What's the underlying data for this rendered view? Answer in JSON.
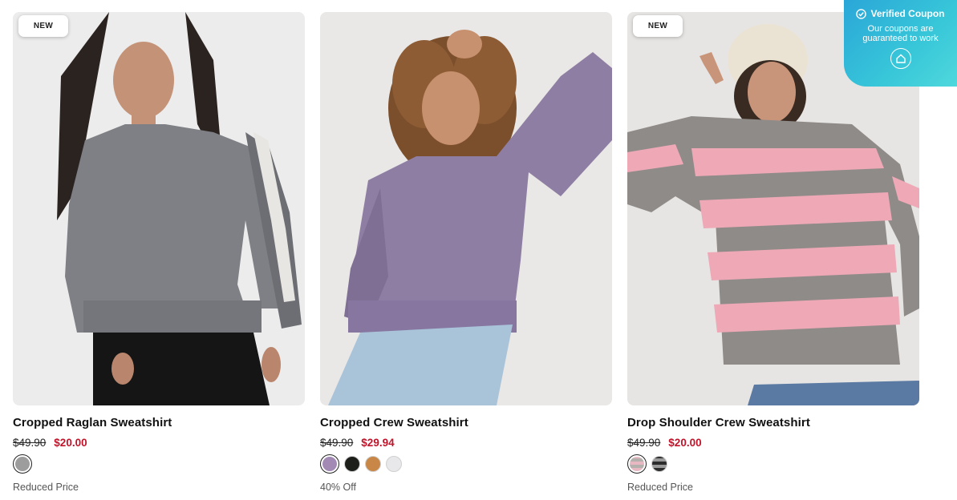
{
  "products": [
    {
      "badge": "NEW",
      "title": "Cropped Raglan Sweatshirt",
      "old_price": "$49.90",
      "new_price": "$20.00",
      "note": "Reduced Price",
      "swatches": [
        {
          "color": "#9d9d9d",
          "selected": true
        }
      ]
    },
    {
      "badge": "",
      "title": "Cropped Crew Sweatshirt",
      "old_price": "$49.90",
      "new_price": "$29.94",
      "note": "40% Off",
      "swatches": [
        {
          "color": "#a38ab5",
          "selected": true
        },
        {
          "color": "#1d1f1a",
          "selected": false
        },
        {
          "color": "#c88746",
          "selected": false
        },
        {
          "color": "#e8e8ea",
          "selected": false
        }
      ]
    },
    {
      "badge": "NEW",
      "title": "Drop Shoulder Crew Sweatshirt",
      "old_price": "$49.90",
      "new_price": "$20.00",
      "note": "Reduced Price",
      "swatches": [
        {
          "color": "#e7b8c2",
          "selected": true
        },
        {
          "color": "#3a3a3a",
          "selected": false
        }
      ]
    }
  ],
  "coupon": {
    "title": "Verified Coupon",
    "subtitle_line1": "Our coupons are",
    "subtitle_line2": "guaranteed to work",
    "icon": "coupon-house-icon"
  },
  "colors": {
    "sale": "#c0142b",
    "coupon_gradient_start": "#2aa6d8",
    "coupon_gradient_end": "#4fd8dc"
  }
}
